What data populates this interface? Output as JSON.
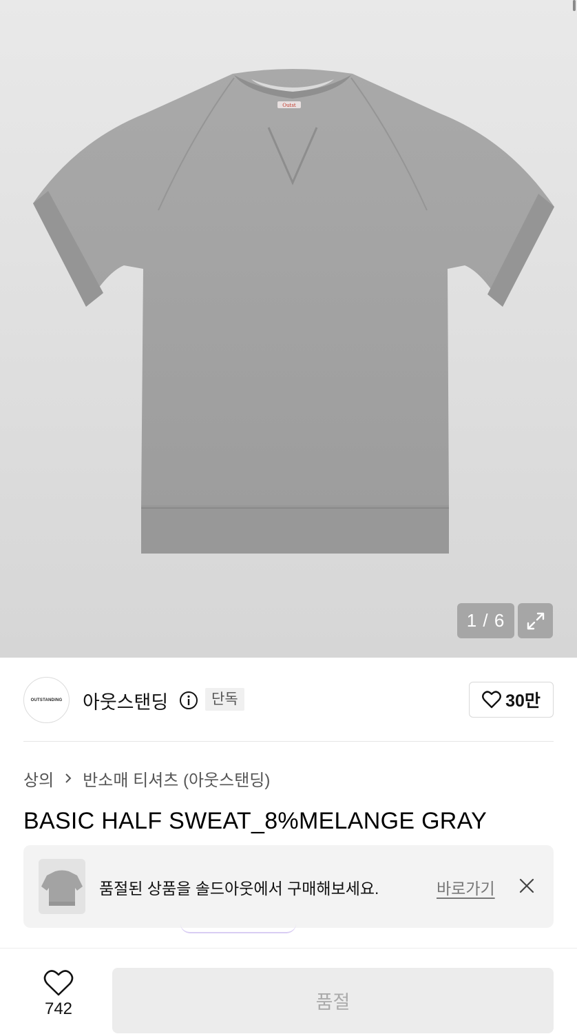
{
  "gallery": {
    "counter": "1 / 6",
    "expand_icon": "expand-icon",
    "shirt_logo_icon": "brand-label-icon"
  },
  "brand": {
    "logo_text": "OUTSTANDING",
    "name": "아웃스탠딩",
    "info_icon": "info-icon",
    "badge": "단독",
    "likes": "30만",
    "like_icon": "heart-icon"
  },
  "breadcrumb": {
    "items": [
      "상의",
      "반소매 티셔츠 (아웃스탠딩)"
    ],
    "separator_icon": "chevron-right-icon"
  },
  "product": {
    "title": "BASIC HALF SWEAT_8%MELANGE GRAY"
  },
  "soldout_banner": {
    "text": "품절된 상품을 솔드아웃에서 구매해보세요.",
    "link": "바로가기",
    "close_icon": "close-icon"
  },
  "bottom_bar": {
    "wish_icon": "heart-icon",
    "wish_count": "742",
    "buy_button": "품절"
  },
  "colors": {
    "gallery_bg": "#e0e0e0",
    "garment": "#a6a6a6",
    "badge_bg": "#f0f0f0",
    "banner_bg": "#f3f3f3",
    "button_disabled_bg": "#ececec",
    "button_disabled_text": "#aaaaaa"
  }
}
